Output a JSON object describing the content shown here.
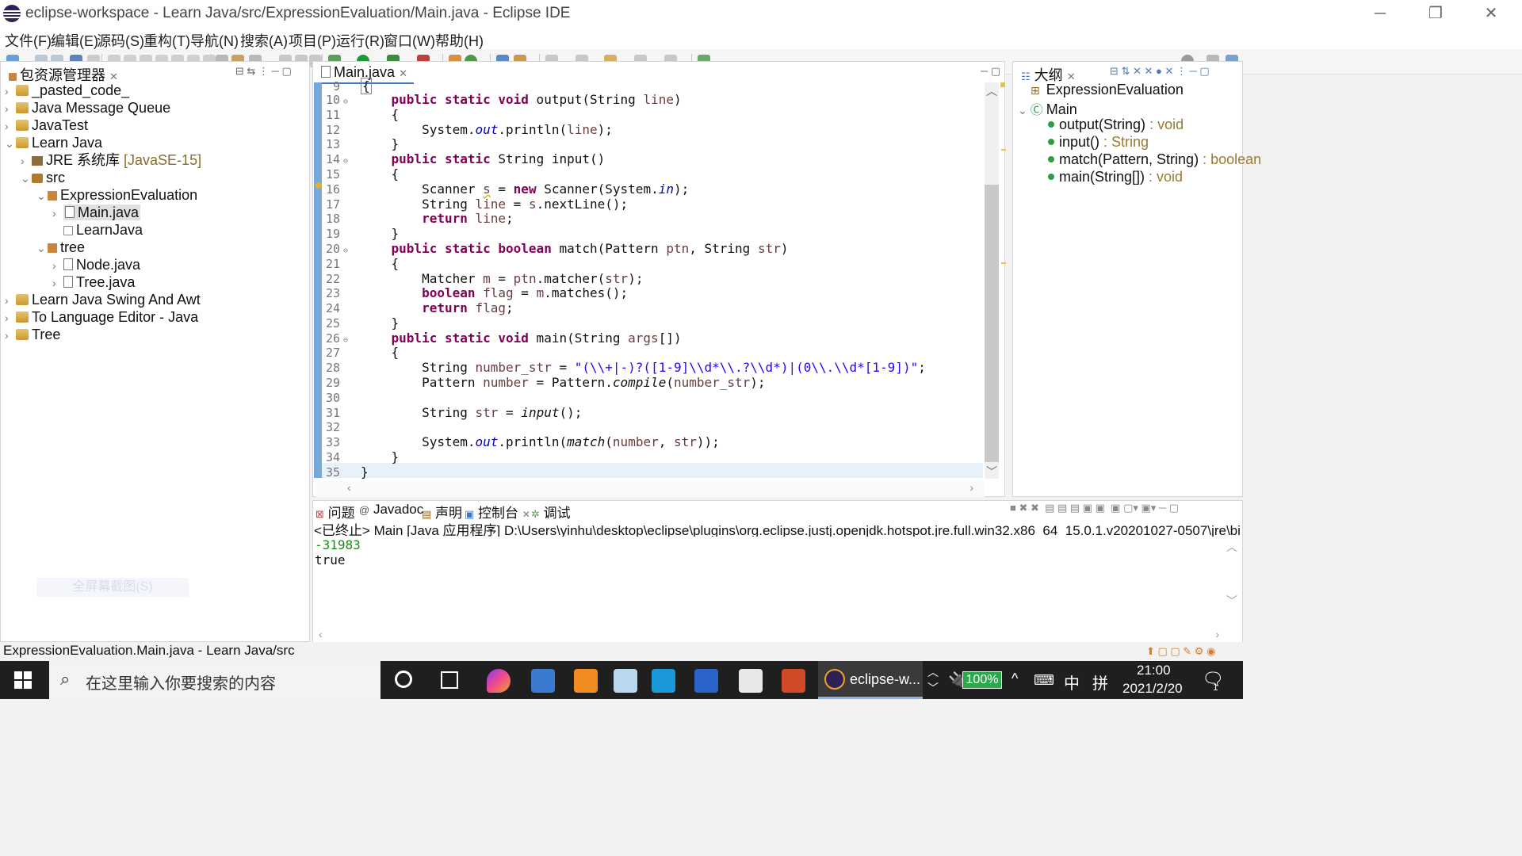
{
  "window": {
    "title": "eclipse-workspace - Learn Java/src/ExpressionEvaluation/Main.java - Eclipse IDE",
    "controls": {
      "minimize": "─",
      "restore": "❐",
      "close": "✕"
    }
  },
  "menu": [
    "文件(F)",
    "编辑(E)",
    "源码(S)",
    "重构(T)",
    "导航(N)",
    "搜索(A)",
    "项目(P)",
    "运行(R)",
    "窗口(W)",
    "帮助(H)"
  ],
  "package_explorer": {
    "tab_label": "包资源管理器",
    "items": [
      {
        "label": "_pasted_code_",
        "chev": "›"
      },
      {
        "label": "Java Message Queue",
        "chev": "›"
      },
      {
        "label": "JavaTest",
        "chev": "›"
      },
      {
        "label": "Learn Java",
        "chev": "⌄"
      },
      {
        "label": "JRE 系统库",
        "extra": "[JavaSE-15]",
        "chev": "›"
      },
      {
        "label": "src",
        "chev": "⌄"
      },
      {
        "label": "ExpressionEvaluation",
        "chev": "⌄"
      },
      {
        "label": "Main.java",
        "chev": "›"
      },
      {
        "label": "LearnJava",
        "chev": ""
      },
      {
        "label": "tree",
        "chev": "⌄"
      },
      {
        "label": "Node.java",
        "chev": "›"
      },
      {
        "label": "Tree.java",
        "chev": "›"
      },
      {
        "label": "Learn Java Swing And Awt",
        "chev": "›"
      },
      {
        "label": "To Language Editor - Java",
        "chev": "›"
      },
      {
        "label": "Tree",
        "chev": "›"
      }
    ],
    "ghost_button": "全屏幕截图(S)"
  },
  "editor": {
    "tab_label": "Main.java",
    "lines": [
      {
        "n": "9",
        "code": ""
      },
      {
        "n": "10",
        "code": "    public static void output(String line)"
      },
      {
        "n": "11",
        "code": "    {"
      },
      {
        "n": "12",
        "code": "        System.out.println(line);"
      },
      {
        "n": "13",
        "code": "    }"
      },
      {
        "n": "14",
        "code": "    public static String input()"
      },
      {
        "n": "15",
        "code": "    {"
      },
      {
        "n": "16",
        "code": "        Scanner s = new Scanner(System.in);"
      },
      {
        "n": "17",
        "code": "        String line = s.nextLine();"
      },
      {
        "n": "18",
        "code": "        return line;"
      },
      {
        "n": "19",
        "code": "    }"
      },
      {
        "n": "20",
        "code": "    public static boolean match(Pattern ptn, String str)"
      },
      {
        "n": "21",
        "code": "    {"
      },
      {
        "n": "22",
        "code": "        Matcher m = ptn.matcher(str);"
      },
      {
        "n": "23",
        "code": "        boolean flag = m.matches();"
      },
      {
        "n": "24",
        "code": "        return flag;"
      },
      {
        "n": "25",
        "code": "    }"
      },
      {
        "n": "26",
        "code": "    public static void main(String args[])"
      },
      {
        "n": "27",
        "code": "    {"
      },
      {
        "n": "28",
        "code": "        String number_str = \"(\\\\+|-)?([1-9]\\\\d*\\\\.?\\\\d*)|(0\\\\.\\\\d*[1-9])\";"
      },
      {
        "n": "29",
        "code": "        Pattern number = Pattern.compile(number_str);"
      },
      {
        "n": "30",
        "code": ""
      },
      {
        "n": "31",
        "code": "        String str = input();"
      },
      {
        "n": "32",
        "code": ""
      },
      {
        "n": "33",
        "code": "        System.out.println(match(number, str));"
      },
      {
        "n": "34",
        "code": "    }"
      },
      {
        "n": "35",
        "code": "}"
      }
    ]
  },
  "outline": {
    "tab_label": "大纲",
    "items": [
      {
        "label": "ExpressionEvaluation",
        "type": ""
      },
      {
        "label": "Main",
        "type": ""
      },
      {
        "label": "output(String)",
        "type": " : void"
      },
      {
        "label": "input()",
        "type": " : String"
      },
      {
        "label": "match(Pattern, String)",
        "type": " : boolean"
      },
      {
        "label": "main(String[])",
        "type": " : void"
      }
    ]
  },
  "console": {
    "tabs": [
      "问题",
      "Javadoc",
      "声明",
      "控制台",
      "调试"
    ],
    "header": "<已终止> Main [Java 应用程序] D:\\Users\\yinhu\\desktop\\eclipse\\plugins\\org.eclipse.justj.openjdk.hotspot.jre.full.win32.x86_64_15.0.1.v20201027-0507\\jre\\bin\\javaw.exe",
    "lines": [
      "-31983",
      "true"
    ]
  },
  "status": {
    "text": "ExpressionEvaluation.Main.java - Learn Java/src"
  },
  "taskbar": {
    "search_placeholder": "在这里输入你要搜索的内容",
    "eclipse_label": "eclipse-w...",
    "battery": "100%",
    "ime": "中",
    "ime2": "拼",
    "time": "21:00",
    "date": "2021/2/20",
    "notif_count": "1"
  }
}
